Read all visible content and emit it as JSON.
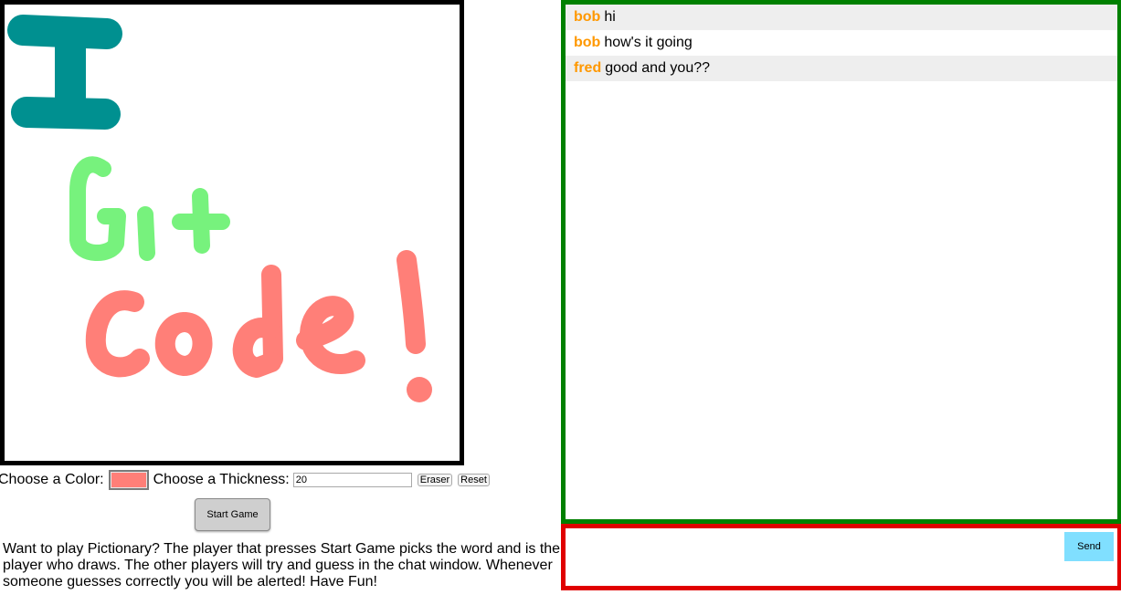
{
  "canvas": {
    "drawing": {
      "letter_I_color": "#009090",
      "git_color": "#77f27d",
      "code_color": "#ff7f78"
    }
  },
  "controls": {
    "color_label": "Choose a Color:",
    "selected_color": "#ff7f78",
    "thickness_label": "Choose a Thickness:",
    "thickness_value": "20",
    "eraser_label": "Eraser",
    "reset_label": "Reset",
    "start_label": "Start Game"
  },
  "instructions": "Want to play Pictionary? The player that presses Start Game picks the word and is the player who draws. The other players will try and guess in the chat window. Whenever someone guesses correctly you will be alerted! Have Fun!",
  "chat": {
    "messages": [
      {
        "user": "bob",
        "text": "hi"
      },
      {
        "user": "bob",
        "text": "how's it going"
      },
      {
        "user": "fred",
        "text": "good and you??"
      }
    ]
  },
  "composer": {
    "input_value": "",
    "send_label": "Send"
  },
  "colors": {
    "canvas_border": "#000000",
    "chat_border": "#008000",
    "composer_border": "#e00000",
    "username": "#ff9800",
    "send_button": "#80dfff"
  }
}
